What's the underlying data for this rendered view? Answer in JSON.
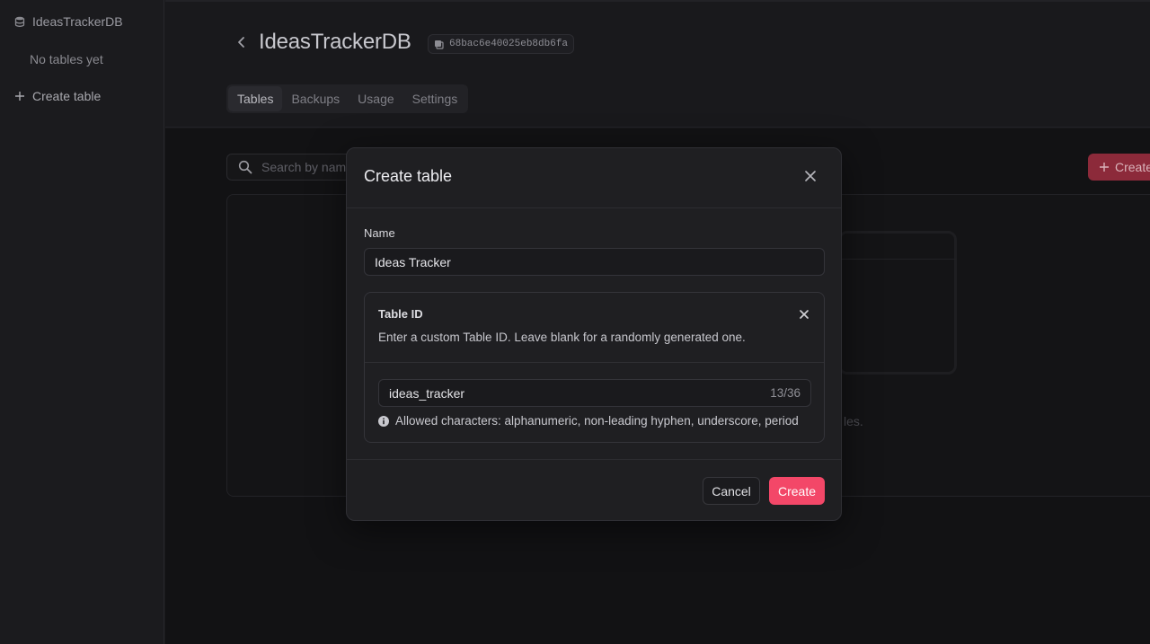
{
  "sidebar": {
    "db_name": "IdeasTrackerDB",
    "empty_text": "No tables yet",
    "create_label": "Create table"
  },
  "header": {
    "title": "IdeasTrackerDB",
    "db_id": "68bac6e40025eb8db6fa",
    "tabs": [
      {
        "label": "Tables",
        "active": true
      },
      {
        "label": "Backups",
        "active": false
      },
      {
        "label": "Usage",
        "active": false
      },
      {
        "label": "Settings",
        "active": false
      }
    ]
  },
  "content": {
    "search_placeholder": "Search by name",
    "create_button": "Create",
    "background_text": "les."
  },
  "modal": {
    "title": "Create table",
    "name_label": "Name",
    "name_value": "Ideas Tracker",
    "table_id": {
      "title": "Table ID",
      "description": "Enter a custom Table ID. Leave blank for a randomly generated one.",
      "value": "ideas_tracker",
      "count": "13/36",
      "hint": "Allowed characters: alphanumeric, non-leading hyphen, underscore, period"
    },
    "cancel_label": "Cancel",
    "create_label": "Create"
  },
  "colors": {
    "accent": "#f34768",
    "background": "#19191c",
    "modal": "#1f1f22"
  },
  "icons": [
    "database-icon",
    "plus-icon",
    "chevron-left-icon",
    "copy-icon",
    "search-icon",
    "close-icon",
    "info-icon"
  ]
}
